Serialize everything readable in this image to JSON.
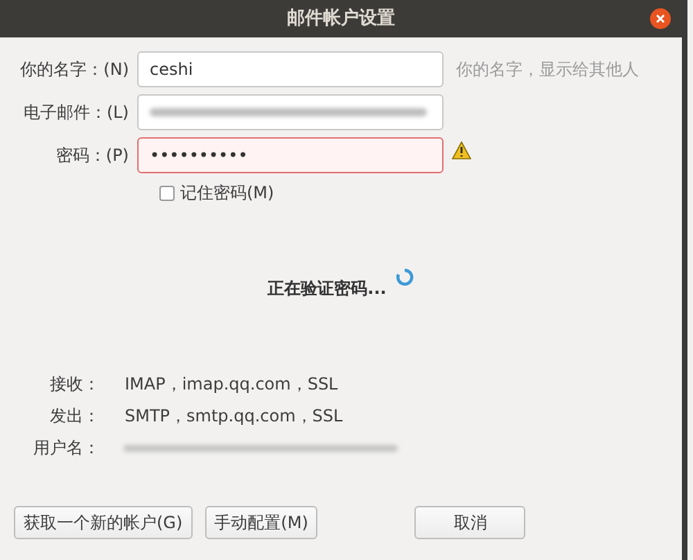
{
  "window": {
    "title": "邮件帐户设置"
  },
  "fields": [
    {
      "label": "你的名字：(N)",
      "value": "ceshi",
      "hint": "你的名字，显示给其他人",
      "kind": "text",
      "invalid": false
    },
    {
      "label": "电子邮件：(L)",
      "kind": "redacted",
      "invalid": false
    },
    {
      "label": "密码：(P)",
      "value": "••••••••••",
      "kind": "password",
      "invalid": true
    }
  ],
  "remember_password": {
    "label": "记住密码(M)",
    "checked": false
  },
  "status": {
    "text": "正在验证密码...",
    "busy": true
  },
  "server_info": [
    {
      "label": "接收：",
      "value": "IMAP，imap.qq.com，SSL",
      "kind": "text"
    },
    {
      "label": "发出：",
      "value": "SMTP，smtp.qq.com，SSL",
      "kind": "text"
    },
    {
      "label": "用户名：",
      "kind": "redacted"
    }
  ],
  "buttons": [
    "获取一个新的帐户(G)",
    "手动配置(M)",
    "取消"
  ]
}
